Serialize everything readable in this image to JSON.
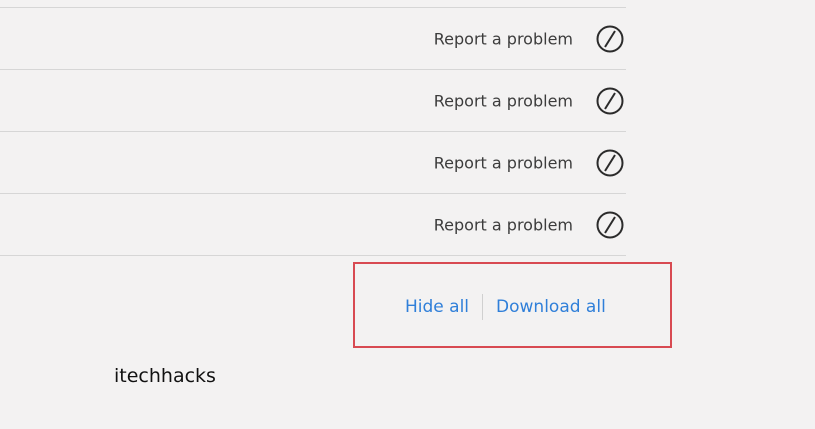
{
  "downloads": {
    "items": [
      {
        "report_label": "Report a problem",
        "icon": "block-icon"
      },
      {
        "report_label": "Report a problem",
        "icon": "block-icon"
      },
      {
        "report_label": "Report a problem",
        "icon": "block-icon"
      },
      {
        "report_label": "Report a problem",
        "icon": "block-icon"
      }
    ]
  },
  "actions": {
    "hide_all_label": "Hide all",
    "download_all_label": "Download all"
  },
  "watermark": "itechhacks",
  "colors": {
    "background": "#f3f2f2",
    "link": "#2f7fd9",
    "highlight": "#d84a52",
    "divider": "#d6d6d6",
    "text": "#3c3c3c"
  }
}
